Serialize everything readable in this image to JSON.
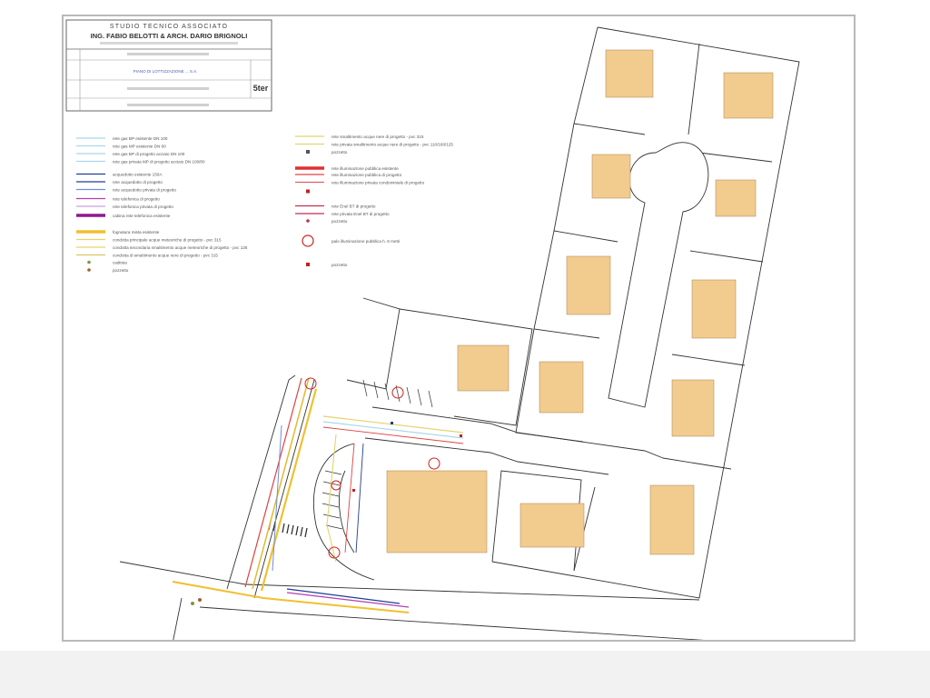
{
  "title_block": {
    "studio": "STUDIO TECNICO ASSOCIATO",
    "engineers": "ING. FABIO BELOTTI & ARCH. DARIO BRIGNOLI",
    "project": "PIANO DI LOTTIZZAZIONE ... S.A.",
    "sheet_code": "5ter"
  },
  "legend": {
    "left": [
      {
        "label": "rete gas BP esistente DN 100",
        "color": "#a8d8ea",
        "style": "solid"
      },
      {
        "label": "rete gas MP esistente DN 80",
        "color": "#a8d8ea",
        "style": "solid"
      },
      {
        "label": "rete gas BP di progetto acciaio DN 100",
        "color": "#a8d8ea",
        "style": "solid"
      },
      {
        "label": "rete gas privata MP di progetto acciaio DN 100/80",
        "color": "#a8d8ea",
        "style": "solid"
      },
      {
        "label": "acquedotto esistente 150A",
        "color": "#1f3d99",
        "style": "solid"
      },
      {
        "label": "rete acquedotto di progetto",
        "color": "#1f3d99",
        "style": "solid"
      },
      {
        "label": "rete acquedotto privata di progetto",
        "color": "#6f8fd6",
        "style": "solid"
      },
      {
        "label": "rete telefonica di progetto",
        "color": "#b040b0",
        "style": "solid"
      },
      {
        "label": "rete telefonica privata di progetto",
        "color": "#c9a0d9",
        "style": "solid"
      },
      {
        "label": "cabina rete telefonica esistente",
        "color": "#8e1a8e",
        "style": "thick"
      },
      {
        "label": "fognatura mista esistente",
        "color": "#f0c030",
        "style": "thick"
      },
      {
        "label": "condotta principale acque meteoriche di progetto - pvc 315",
        "color": "#e6d36a",
        "style": "solid"
      },
      {
        "label": "condotta secondaria smaltimento acque meteoriche di progetto - pvc 125",
        "color": "#e6d36a",
        "style": "solid"
      },
      {
        "label": "condotta di smaltimento acque nere di progetto - pvc 315",
        "color": "#d9c46b",
        "style": "solid"
      },
      {
        "label": "caditoia",
        "color": "#7a9a3a",
        "style": "dot"
      },
      {
        "label": "pozzetto",
        "color": "#a06030",
        "style": "dot"
      }
    ],
    "right": [
      {
        "label": "rete smaltimento acque nere di progetto - pvc 315",
        "color": "#e6d36a",
        "style": "solid"
      },
      {
        "label": "rete privata smaltimento acque nere di progetto - pvc 110/160/125",
        "color": "#e6d36a",
        "style": "solid"
      },
      {
        "label": "pozzetto",
        "color": "#555555",
        "style": "square"
      },
      {
        "label": "rete illuminazione pubblica esistente",
        "color": "#e03030",
        "style": "thick"
      },
      {
        "label": "rete illuminazione pubblica di progetto",
        "color": "#e04040",
        "style": "solid"
      },
      {
        "label": "rete illuminazione privata condominiale di progetto",
        "color": "#e06060",
        "style": "solid"
      },
      {
        "label": "",
        "color": "#c02020",
        "style": "square"
      },
      {
        "label": "rete Enel BT di progetto",
        "color": "#c03050",
        "style": "solid"
      },
      {
        "label": "rete privata Enel BT di progetto",
        "color": "#c03050",
        "style": "solid"
      },
      {
        "label": "pozzetto",
        "color": "#c03050",
        "style": "dot"
      },
      {
        "label": "palo illuminazione pubblica h. 8 metri",
        "color": "#d02020",
        "style": "circle"
      },
      {
        "label": "pozzetto",
        "color": "#c02020",
        "style": "square"
      }
    ]
  },
  "colors": {
    "building_fill": "#f2cb8f",
    "building_stroke": "#b89060",
    "plot_line": "#333333"
  }
}
